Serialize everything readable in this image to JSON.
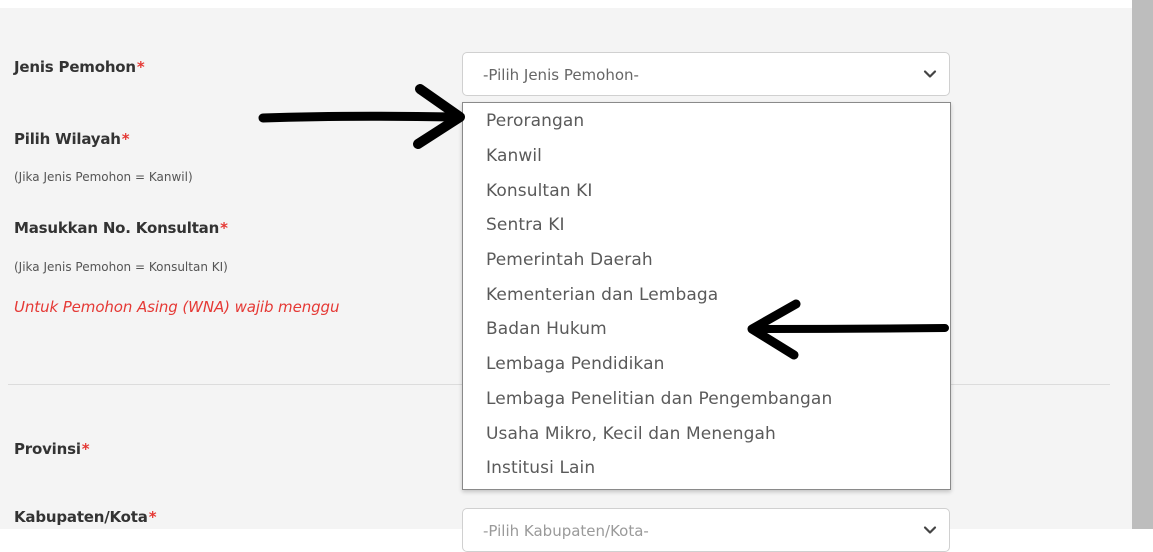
{
  "form": {
    "jenis_pemohon_label": "Jenis Pemohon",
    "pilih_wilayah_label": "Pilih Wilayah",
    "pilih_wilayah_hint": "(Jika Jenis Pemohon = Kanwil)",
    "konsultan_label": "Masukkan No. Konsultan",
    "konsultan_hint": "(Jika Jenis Pemohon = Konsultan KI)",
    "warning_text": "Untuk Pemohon Asing (WNA) wajib menggu",
    "provinsi_label": "Provinsi",
    "kabupaten_label": "Kabupaten/Kota",
    "required_mark": "*"
  },
  "jenis_select": {
    "placeholder": "-Pilih Jenis Pemohon-"
  },
  "kabupaten_select": {
    "placeholder": "-Pilih Kabupaten/Kota-"
  },
  "dropdown": {
    "options": [
      "Perorangan",
      "Kanwil",
      "Konsultan KI",
      "Sentra KI",
      "Pemerintah Daerah",
      "Kementerian dan Lembaga",
      "Badan Hukum",
      "Lembaga Pendidikan",
      "Lembaga Penelitian dan Pengembangan",
      "Usaha Mikro, Kecil dan Menengah",
      "Institusi Lain"
    ]
  },
  "icons": {
    "chevron": "chevron-down-icon",
    "annotation_arrows": "arrow-icon"
  },
  "colors": {
    "required": "#e53935",
    "warning": "#e53935"
  }
}
